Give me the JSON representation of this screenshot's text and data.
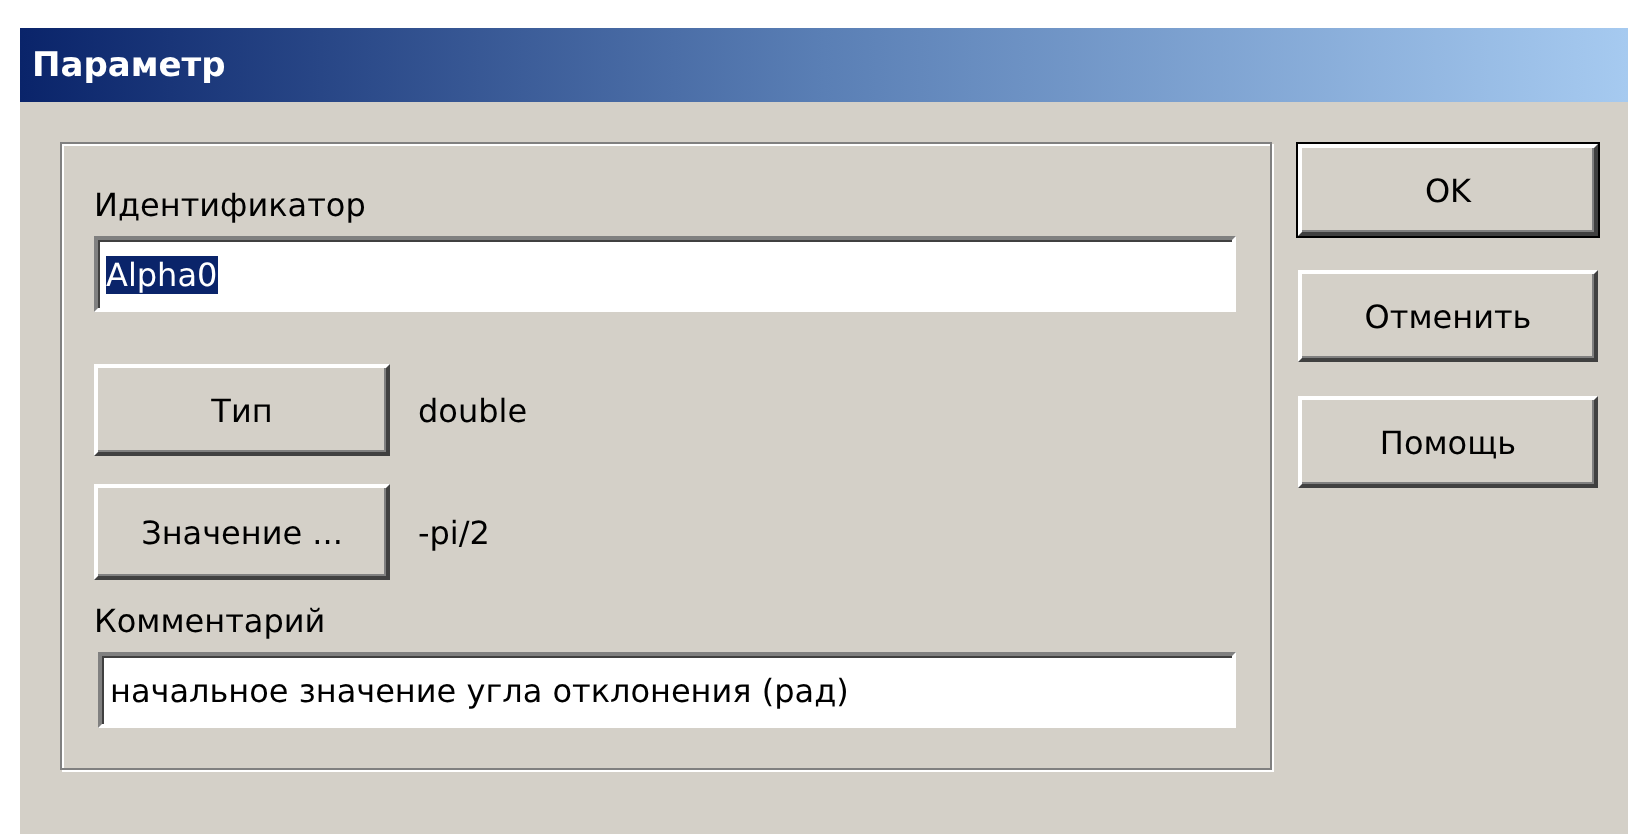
{
  "window": {
    "title": "Параметр"
  },
  "identifier": {
    "label": "Идентификатор",
    "value": "Alpha0",
    "selected": true
  },
  "type": {
    "button": "Тип",
    "value": "double"
  },
  "value": {
    "button": "Значение ...",
    "value": "-pi/2"
  },
  "comment": {
    "label": "Комментарий",
    "value": "начальное значение угла отклонения (рад)"
  },
  "buttons": [
    {
      "label": "OK",
      "default": true
    },
    {
      "label": "Отменить",
      "default": false
    },
    {
      "label": "Помощь",
      "default": false
    }
  ]
}
